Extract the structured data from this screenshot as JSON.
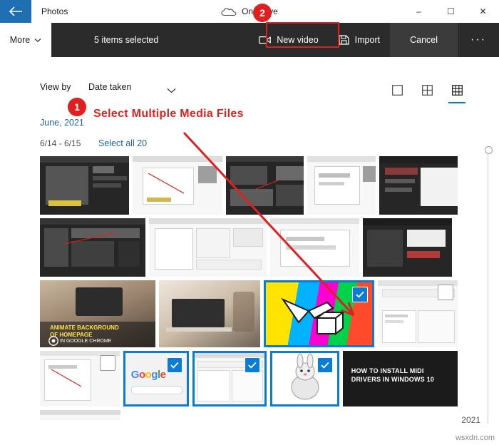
{
  "window": {
    "app_title": "Photos",
    "account_label": "OneDrive",
    "back_icon": "back-arrow-icon",
    "cloud_icon": "onedrive-cloud-icon",
    "minimize": "–",
    "maximize": "☐",
    "close": "✕"
  },
  "commandbar": {
    "more_label": "More",
    "more_chevron": "⌄",
    "selection_text": "5 items selected",
    "new_video_label": "New video",
    "new_video_icon": "video-camera-icon",
    "import_label": "Import",
    "import_icon": "import-icon",
    "cancel_label": "Cancel",
    "ellipsis_label": "···"
  },
  "viewbar": {
    "view_by_label": "View by",
    "view_by_value": "Date taken",
    "chevron_icon": "chevron-down-icon",
    "layouts": [
      {
        "name": "layout-large-icon",
        "active": false
      },
      {
        "name": "layout-medium-icon",
        "active": false
      },
      {
        "name": "layout-small-icon",
        "active": true
      }
    ]
  },
  "header": {
    "month_label": "June, 2021",
    "date_range": "6/14 - 6/15",
    "select_all_label": "Select all 20"
  },
  "grid": {
    "rows": [
      {
        "height": 82,
        "tiles": [
          {
            "name": "photo-tile",
            "kind": "dark-code",
            "width": 143,
            "selected": false,
            "checkbox": "none"
          },
          {
            "name": "photo-tile",
            "kind": "light-doc",
            "width": 143,
            "selected": false,
            "checkbox": "none"
          },
          {
            "name": "photo-tile",
            "kind": "dark-code",
            "width": 125,
            "selected": false,
            "checkbox": "none"
          },
          {
            "name": "photo-tile",
            "kind": "light-doc",
            "width": 110,
            "selected": false,
            "checkbox": "none"
          },
          {
            "name": "photo-tile",
            "kind": "dark-doc",
            "width": 125,
            "selected": false,
            "checkbox": "none"
          }
        ]
      },
      {
        "height": 82,
        "tiles": [
          {
            "name": "photo-tile",
            "kind": "dark-code",
            "width": 148,
            "selected": false,
            "checkbox": "none"
          },
          {
            "name": "photo-tile",
            "kind": "light-doc",
            "width": 165,
            "selected": false,
            "checkbox": "none"
          },
          {
            "name": "photo-tile",
            "kind": "light-doc",
            "width": 125,
            "selected": false,
            "checkbox": "none"
          },
          {
            "name": "photo-tile",
            "kind": "dark-doc",
            "width": 125,
            "selected": false,
            "checkbox": "none"
          }
        ]
      },
      {
        "height": 94,
        "tiles": [
          {
            "name": "photo-tile",
            "kind": "photo-desk-chrome",
            "width": 163,
            "selected": false,
            "checkbox": "none"
          },
          {
            "name": "photo-tile",
            "kind": "photo-laptop",
            "width": 143,
            "selected": false,
            "checkbox": "none"
          },
          {
            "name": "photo-tile",
            "kind": "photo-rainbow",
            "width": 155,
            "selected": true,
            "checkbox": "checked"
          },
          {
            "name": "photo-tile",
            "kind": "light-doc",
            "width": 113,
            "selected": false,
            "checkbox": "empty"
          }
        ]
      },
      {
        "height": 78,
        "tiles": [
          {
            "name": "photo-tile",
            "kind": "light-doc",
            "width": 113,
            "selected": false,
            "checkbox": "empty"
          },
          {
            "name": "photo-tile",
            "kind": "photo-google",
            "width": 93,
            "selected": true,
            "checkbox": "checked"
          },
          {
            "name": "photo-tile",
            "kind": "light-doc",
            "width": 105,
            "selected": true,
            "checkbox": "checked"
          },
          {
            "name": "photo-tile",
            "kind": "photo-rabbit",
            "width": 98,
            "selected": true,
            "checkbox": "checked"
          },
          {
            "name": "photo-tile",
            "kind": "photo-midi-text",
            "width": 163,
            "selected": false,
            "checkbox": "none",
            "caption": "HOW TO INSTALL MIDI DRIVERS IN WINDOWS 10"
          }
        ]
      }
    ],
    "partial_row_tile": {
      "name": "photo-tile",
      "kind": "light-doc"
    }
  },
  "annotations": {
    "badge1": "1",
    "badge2": "2",
    "callout_text": "Select Multiple Media Files",
    "arrow_color": "#e02020"
  },
  "scrollbar": {
    "thumb_name": "scroll-thumb",
    "track_name": "scroll-track"
  },
  "footer": {
    "year_label": "2021",
    "watermark": "wsxdn.com"
  }
}
